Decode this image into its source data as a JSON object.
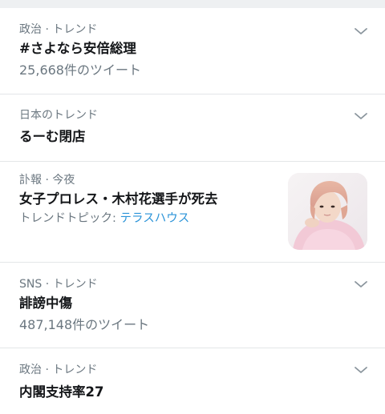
{
  "trends": [
    {
      "meta": "政治 · トレンド",
      "title": "#さよなら安倍総理",
      "count": "25,668件のツイート",
      "more_icon": "chevron-down-icon"
    },
    {
      "meta": "日本のトレンド",
      "title": "るーむ閉店",
      "more_icon": "chevron-down-icon"
    },
    {
      "meta": "訃報 · 今夜",
      "title": "女子プロレス・木村花選手が死去",
      "topic_prefix": "トレンドトピック: ",
      "topic_link": "テラスハウス",
      "thumbnail": "news-thumbnail"
    },
    {
      "meta": "SNS · トレンド",
      "title": "誹謗中傷",
      "count": "487,148件のツイート",
      "more_icon": "chevron-down-icon"
    },
    {
      "meta": "政治 · トレンド",
      "title": "内閣支持率27",
      "more_icon": "chevron-down-icon"
    }
  ],
  "colors": {
    "meta_text": "#6b7780",
    "title_text": "#141619",
    "link": "#2a93d8",
    "divider": "#e3e6e8",
    "chevron": "#8a959d"
  }
}
